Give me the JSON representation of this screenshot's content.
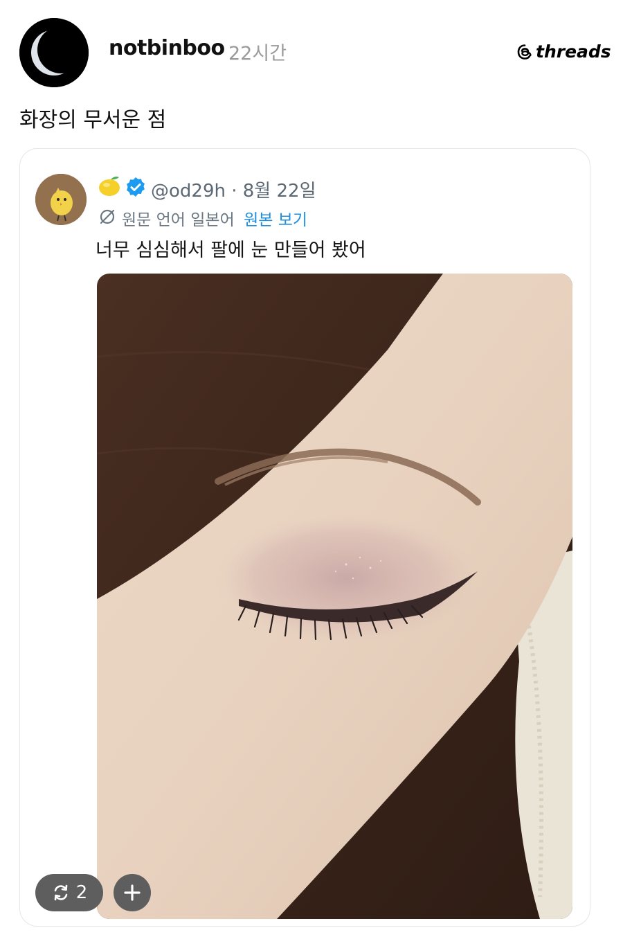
{
  "post": {
    "username": "notbinboo",
    "time": "22시간",
    "brand": "threads",
    "text": "화장의 무서운 점"
  },
  "embedded_tweet": {
    "handle": "@od29h · 8월 22일",
    "translation_note": "원문 언어 일본어",
    "translation_link": "원본 보기",
    "text": "너무 심심해서 팔에 눈 만들어 봤어",
    "photo_description_icon": "arm-eye-makeup-photo"
  },
  "actions": {
    "repost_count": "2"
  },
  "colors": {
    "link_blue": "#1d8ee0",
    "verified_blue": "#1d9bf0",
    "muted_text": "#9a9a9a",
    "button_gray": "#5e5e5e"
  }
}
